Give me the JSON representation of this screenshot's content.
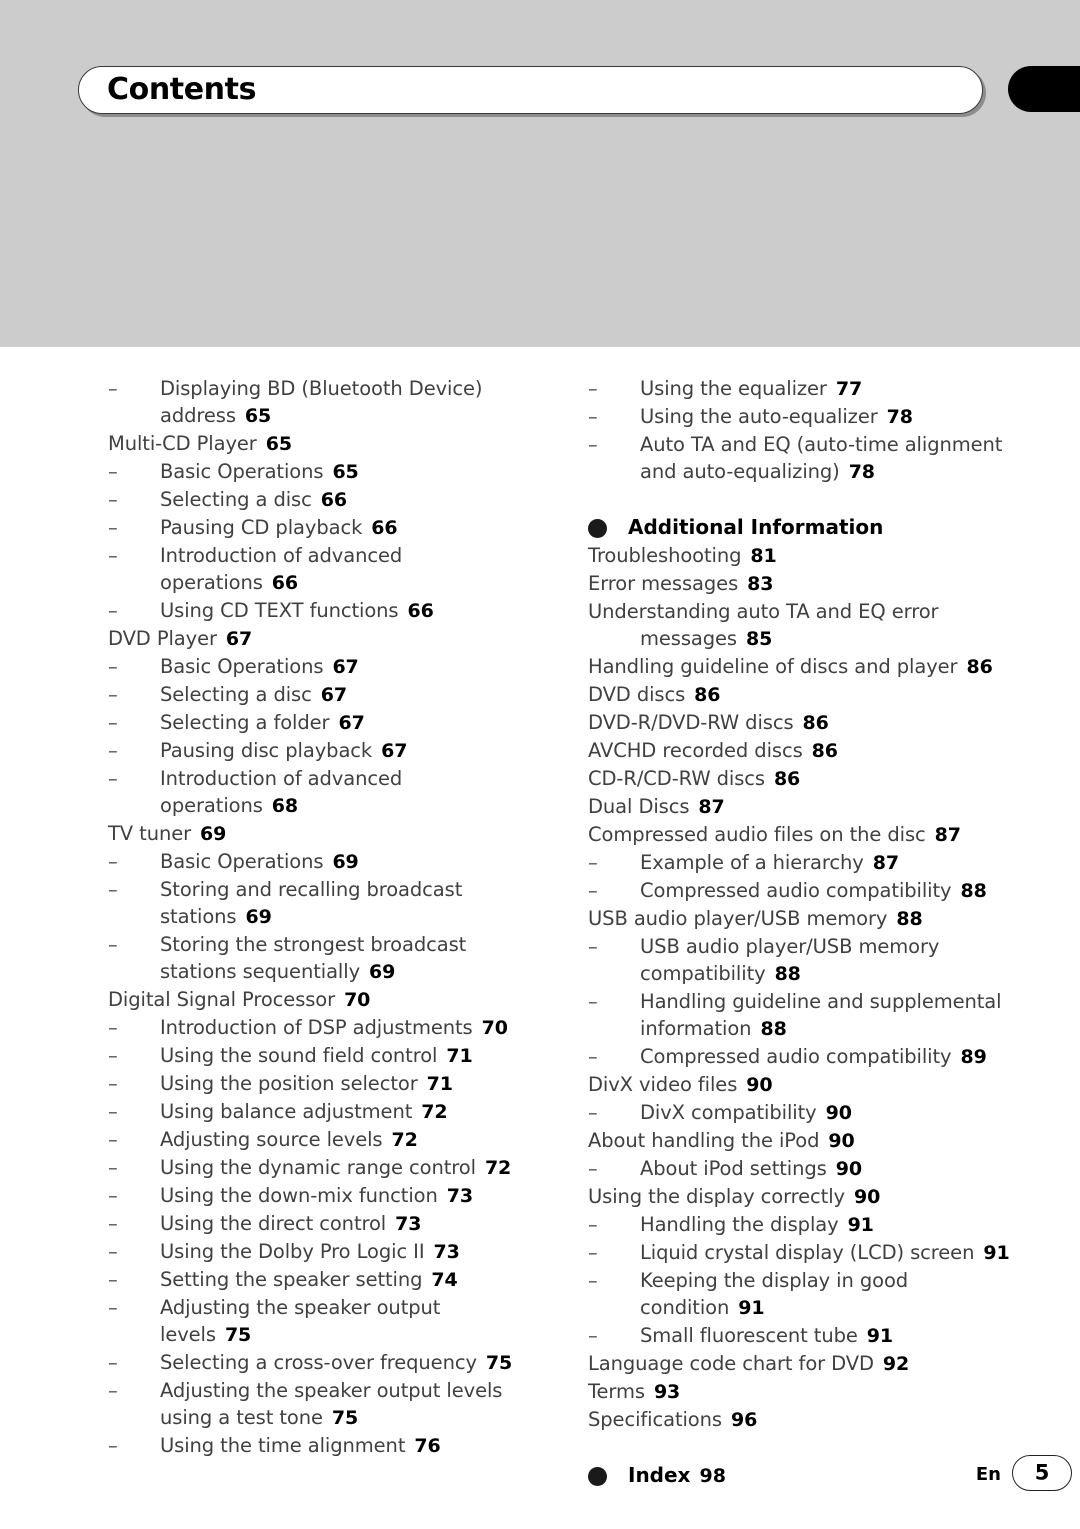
{
  "header": {
    "title": "Contents",
    "tab_icon": "black-edge-tab"
  },
  "footer": {
    "language": "En",
    "page_number": "5"
  },
  "colors": {
    "header_band": "#cccccc",
    "text": "#404040",
    "page_number_text": "#000000",
    "tab": "#000000"
  },
  "left_column": [
    {
      "type": "sub",
      "dash": "–",
      "label": "Displaying BD (Bluetooth Device)",
      "page": ""
    },
    {
      "type": "cont",
      "label": "address",
      "page": "65"
    },
    {
      "type": "main",
      "label": "Multi-CD Player",
      "page": "65"
    },
    {
      "type": "sub",
      "dash": "–",
      "label": "Basic Operations",
      "page": "65"
    },
    {
      "type": "sub",
      "dash": "–",
      "label": "Selecting a disc",
      "page": "66"
    },
    {
      "type": "sub",
      "dash": "–",
      "label": "Pausing CD playback",
      "page": "66"
    },
    {
      "type": "sub",
      "dash": "–",
      "label": "Introduction of advanced",
      "page": ""
    },
    {
      "type": "cont",
      "label": "operations",
      "page": "66"
    },
    {
      "type": "sub",
      "dash": "–",
      "label": "Using CD TEXT functions",
      "page": "66"
    },
    {
      "type": "main",
      "label": "DVD Player",
      "page": "67"
    },
    {
      "type": "sub",
      "dash": "–",
      "label": "Basic Operations",
      "page": "67"
    },
    {
      "type": "sub",
      "dash": "–",
      "label": "Selecting a disc",
      "page": "67"
    },
    {
      "type": "sub",
      "dash": "–",
      "label": "Selecting a folder",
      "page": "67"
    },
    {
      "type": "sub",
      "dash": "–",
      "label": "Pausing disc playback",
      "page": "67"
    },
    {
      "type": "sub",
      "dash": "–",
      "label": "Introduction of advanced",
      "page": ""
    },
    {
      "type": "cont",
      "label": "operations",
      "page": "68"
    },
    {
      "type": "main",
      "label": "TV tuner",
      "page": "69"
    },
    {
      "type": "sub",
      "dash": "–",
      "label": "Basic Operations",
      "page": "69"
    },
    {
      "type": "sub",
      "dash": "–",
      "label": "Storing and recalling broadcast",
      "page": ""
    },
    {
      "type": "cont",
      "label": "stations",
      "page": "69"
    },
    {
      "type": "sub",
      "dash": "–",
      "label": "Storing the strongest broadcast",
      "page": ""
    },
    {
      "type": "cont",
      "label": "stations sequentially",
      "page": "69"
    },
    {
      "type": "main",
      "label": "Digital Signal Processor",
      "page": "70"
    },
    {
      "type": "sub",
      "dash": "–",
      "label": "Introduction of DSP adjustments",
      "page": "70"
    },
    {
      "type": "sub",
      "dash": "–",
      "label": "Using the sound field control",
      "page": "71"
    },
    {
      "type": "sub",
      "dash": "–",
      "label": "Using the position selector",
      "page": "71"
    },
    {
      "type": "sub",
      "dash": "–",
      "label": "Using balance adjustment",
      "page": "72"
    },
    {
      "type": "sub",
      "dash": "–",
      "label": "Adjusting source levels",
      "page": "72"
    },
    {
      "type": "sub",
      "dash": "–",
      "label": "Using the dynamic range control",
      "page": "72"
    },
    {
      "type": "sub",
      "dash": "–",
      "label": "Using the down-mix function",
      "page": "73"
    },
    {
      "type": "sub",
      "dash": "–",
      "label": "Using the direct control",
      "page": "73"
    },
    {
      "type": "sub",
      "dash": "–",
      "label": "Using the Dolby Pro Logic II",
      "page": "73"
    },
    {
      "type": "sub",
      "dash": "–",
      "label": "Setting the speaker setting",
      "page": "74"
    },
    {
      "type": "sub",
      "dash": "–",
      "label": "Adjusting the speaker output",
      "page": ""
    },
    {
      "type": "cont",
      "label": "levels",
      "page": "75"
    },
    {
      "type": "sub",
      "dash": "–",
      "label": "Selecting a cross-over frequency",
      "page": "75"
    },
    {
      "type": "sub",
      "dash": "–",
      "label": "Adjusting the speaker output levels",
      "page": ""
    },
    {
      "type": "cont",
      "label": "using a test tone",
      "page": "75"
    },
    {
      "type": "sub",
      "dash": "–",
      "label": "Using the time alignment",
      "page": "76"
    }
  ],
  "right_column": [
    {
      "type": "sub",
      "dash": "–",
      "label": "Using the equalizer",
      "page": "77"
    },
    {
      "type": "sub",
      "dash": "–",
      "label": "Using the auto-equalizer",
      "page": "78"
    },
    {
      "type": "sub",
      "dash": "–",
      "label": "Auto TA and EQ (auto-time alignment",
      "page": ""
    },
    {
      "type": "cont",
      "label": "and auto-equalizing)",
      "page": "78"
    },
    {
      "type": "section",
      "label": "Additional Information",
      "page": ""
    },
    {
      "type": "main",
      "label": "Troubleshooting",
      "page": "81"
    },
    {
      "type": "main",
      "label": "Error messages",
      "page": "83"
    },
    {
      "type": "main",
      "label": "Understanding auto TA and EQ error",
      "page": ""
    },
    {
      "type": "cont",
      "label": "messages",
      "page": "85"
    },
    {
      "type": "main",
      "label": "Handling guideline of discs and player",
      "page": "86"
    },
    {
      "type": "main",
      "label": "DVD discs",
      "page": "86"
    },
    {
      "type": "main",
      "label": "DVD-R/DVD-RW discs",
      "page": "86"
    },
    {
      "type": "main",
      "label": "AVCHD recorded discs",
      "page": "86"
    },
    {
      "type": "main",
      "label": "CD-R/CD-RW discs",
      "page": "86"
    },
    {
      "type": "main",
      "label": "Dual Discs",
      "page": "87"
    },
    {
      "type": "main",
      "label": "Compressed audio files on the disc",
      "page": "87"
    },
    {
      "type": "sub",
      "dash": "–",
      "label": "Example of a hierarchy",
      "page": "87"
    },
    {
      "type": "sub",
      "dash": "–",
      "label": "Compressed audio compatibility",
      "page": "88"
    },
    {
      "type": "main",
      "label": "USB audio player/USB memory",
      "page": "88"
    },
    {
      "type": "sub",
      "dash": "–",
      "label": "USB audio player/USB memory",
      "page": ""
    },
    {
      "type": "cont",
      "label": "compatibility",
      "page": "88"
    },
    {
      "type": "sub",
      "dash": "–",
      "label": "Handling guideline and supplemental",
      "page": ""
    },
    {
      "type": "cont",
      "label": "information",
      "page": "88"
    },
    {
      "type": "sub",
      "dash": "–",
      "label": "Compressed audio compatibility",
      "page": "89"
    },
    {
      "type": "main",
      "label": "DivX video files",
      "page": "90"
    },
    {
      "type": "sub",
      "dash": "–",
      "label": "DivX compatibility",
      "page": "90"
    },
    {
      "type": "main",
      "label": "About handling the iPod",
      "page": "90"
    },
    {
      "type": "sub",
      "dash": "–",
      "label": "About iPod settings",
      "page": "90"
    },
    {
      "type": "main",
      "label": "Using the display correctly",
      "page": "90"
    },
    {
      "type": "sub",
      "dash": "–",
      "label": "Handling the display",
      "page": "91"
    },
    {
      "type": "sub",
      "dash": "–",
      "label": "Liquid crystal display (LCD) screen",
      "page": "91"
    },
    {
      "type": "sub",
      "dash": "–",
      "label": "Keeping the display in good",
      "page": ""
    },
    {
      "type": "cont",
      "label": "condition",
      "page": "91"
    },
    {
      "type": "sub",
      "dash": "–",
      "label": "Small fluorescent tube",
      "page": "91"
    },
    {
      "type": "main",
      "label": "Language code chart for DVD",
      "page": "92"
    },
    {
      "type": "main",
      "label": "Terms",
      "page": "93"
    },
    {
      "type": "main",
      "label": "Specifications",
      "page": "96"
    },
    {
      "type": "section",
      "label": "Index",
      "page": "98"
    }
  ]
}
